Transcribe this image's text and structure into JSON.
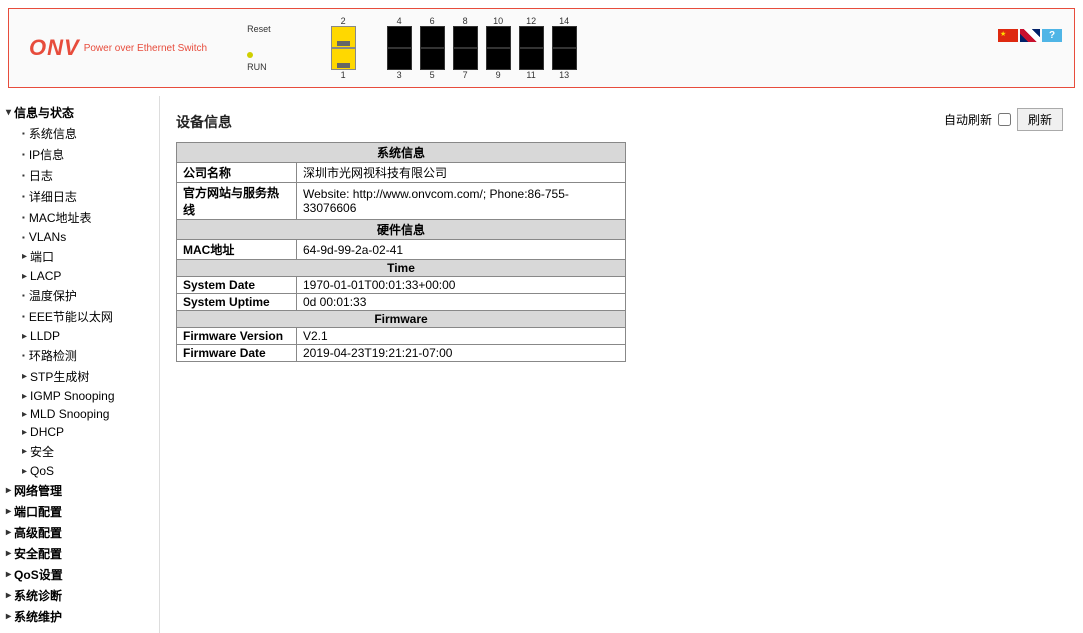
{
  "logo": {
    "brand": "ONV",
    "tagline": "Power over Ethernet Switch"
  },
  "header": {
    "reset_label": "Reset",
    "run_label": "RUN",
    "port_numbers_top": [
      "2",
      "4",
      "6",
      "8",
      "10",
      "12",
      "14"
    ],
    "port_numbers_bottom": [
      "1",
      "3",
      "5",
      "7",
      "9",
      "11",
      "13"
    ]
  },
  "flags": {
    "help": "?"
  },
  "sidebar": {
    "s_info_status": "信息与状态",
    "items": [
      {
        "label": "系统信息",
        "type": "leaf"
      },
      {
        "label": "IP信息",
        "type": "leaf"
      },
      {
        "label": "日志",
        "type": "leaf"
      },
      {
        "label": "详细日志",
        "type": "leaf"
      },
      {
        "label": "MAC地址表",
        "type": "leaf"
      },
      {
        "label": "VLANs",
        "type": "leaf"
      },
      {
        "label": "端口",
        "type": "branch"
      },
      {
        "label": "LACP",
        "type": "branch"
      },
      {
        "label": "温度保护",
        "type": "leaf"
      },
      {
        "label": "EEE节能以太网",
        "type": "leaf"
      },
      {
        "label": "LLDP",
        "type": "branch"
      },
      {
        "label": "环路检测",
        "type": "leaf"
      },
      {
        "label": "STP生成树",
        "type": "branch"
      },
      {
        "label": "IGMP Snooping",
        "type": "branch"
      },
      {
        "label": "MLD Snooping",
        "type": "branch"
      },
      {
        "label": "DHCP",
        "type": "branch"
      },
      {
        "label": "安全",
        "type": "branch"
      },
      {
        "label": "QoS",
        "type": "branch"
      }
    ],
    "s_net_mgmt": "网络管理",
    "s_port_cfg": "端口配置",
    "s_adv_cfg": "高级配置",
    "s_sec_cfg": "安全配置",
    "s_qos_cfg": "QoS设置",
    "s_diag": "系统诊断",
    "s_maint": "系统维护"
  },
  "main": {
    "title": "设备信息",
    "auto_refresh_label": "自动刷新",
    "refresh_btn": "刷新",
    "sections": {
      "sys": {
        "header": "系统信息",
        "company_label": "公司名称",
        "company_value": "深圳市光网视科技有限公司",
        "website_label": "官方网站与服务热线",
        "website_value": "Website: http://www.onvcom.com/; Phone:86-755-33076606"
      },
      "hw": {
        "header": "硬件信息",
        "mac_label": "MAC地址",
        "mac_value": "64-9d-99-2a-02-41"
      },
      "time": {
        "header": "Time",
        "date_label": "System Date",
        "date_value": "1970-01-01T00:01:33+00:00",
        "uptime_label": "System Uptime",
        "uptime_value": "0d 00:01:33"
      },
      "fw": {
        "header": "Firmware",
        "ver_label": "Firmware Version",
        "ver_value": "V2.1",
        "fwdate_label": "Firmware Date",
        "fwdate_value": "2019-04-23T19:21:21-07:00"
      }
    }
  }
}
